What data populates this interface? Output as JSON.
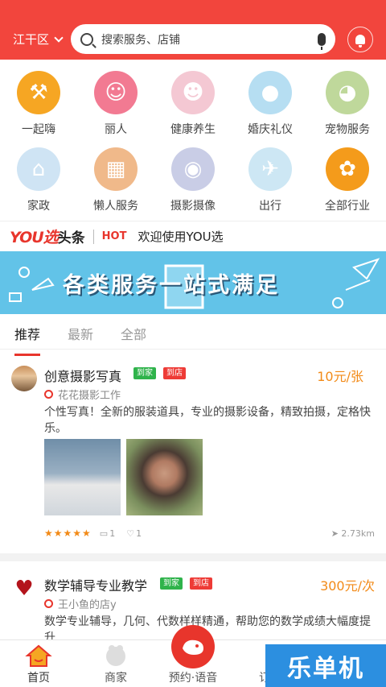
{
  "header": {
    "district": "江干区",
    "search_placeholder": "搜索服务、店铺"
  },
  "categories": [
    {
      "label": "一起嗨",
      "icon": "dumbbell-icon",
      "color": "#f6a623"
    },
    {
      "label": "丽人",
      "icon": "beauty-icon",
      "color": "#f27a92"
    },
    {
      "label": "健康养生",
      "icon": "face-mask-icon",
      "color": "#f4c8d3"
    },
    {
      "label": "婚庆礼仪",
      "icon": "balloons-icon",
      "color": "#b6def2"
    },
    {
      "label": "宠物服务",
      "icon": "monkey-icon",
      "color": "#bfd89b"
    },
    {
      "label": "家政",
      "icon": "vacuum-icon",
      "color": "#cfe4f4"
    },
    {
      "label": "懒人服务",
      "icon": "calculator-icon",
      "color": "#f0b98a"
    },
    {
      "label": "摄影摄像",
      "icon": "camera-icon",
      "color": "#c9cde6"
    },
    {
      "label": "出行",
      "icon": "airplane-icon",
      "color": "#cde7f4"
    },
    {
      "label": "全部行业",
      "icon": "grid-icon",
      "color": "#f49b1b"
    }
  ],
  "ticker": {
    "brand_you": "YOU选",
    "brand_rest": "头条",
    "hot": "HOT",
    "text": "欢迎使用YOU选"
  },
  "banner": {
    "text": "各类服务一站式满足"
  },
  "tabs": [
    "推荐",
    "最新",
    "全部"
  ],
  "posts": [
    {
      "title": "创意摄影写真",
      "badge_home": "到家",
      "badge_store": "到店",
      "price": "10元/张",
      "shop": "花花摄影工作",
      "desc": "个性写真！全新的服装道具，专业的摄影设备，精致拍摄，定格快乐。",
      "stars": "★★★★★",
      "comments": "1",
      "likes": "1",
      "distance": "2.73km"
    },
    {
      "title": "数学辅导专业教学",
      "badge_home": "到家",
      "badge_store": "到店",
      "price": "300元/次",
      "shop": "王小鱼的店y",
      "desc": "数学专业辅导，几何、代数样样精通，帮助您的数学成绩大幅度提升"
    }
  ],
  "tabbar": {
    "home": "首页",
    "merchant": "商家",
    "booking": "预约·语音",
    "orders": "订单"
  },
  "watermark": "乐单机"
}
